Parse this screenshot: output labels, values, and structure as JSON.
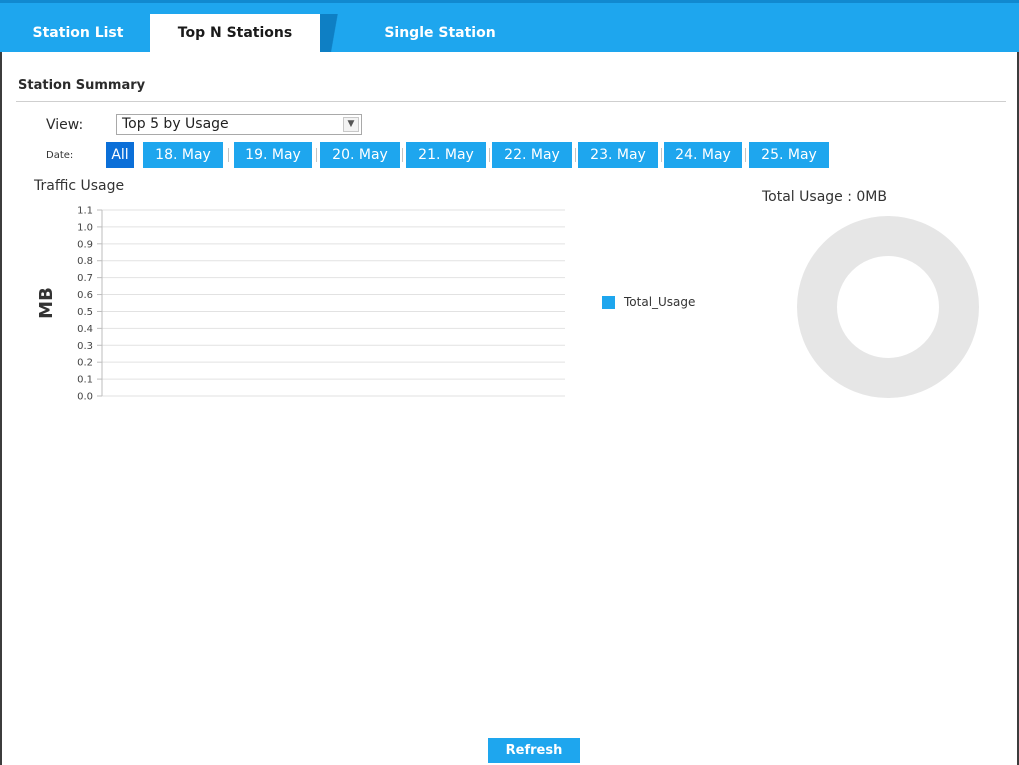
{
  "tabs": [
    {
      "label": "Station List",
      "active": false
    },
    {
      "label": "Top N Stations",
      "active": true
    },
    {
      "label": "Single Station",
      "active": false
    }
  ],
  "summary": {
    "title": "Station Summary",
    "view_label": "View:",
    "view_value": "Top 5 by Usage",
    "date_label": "Date:",
    "dates": [
      "All",
      "18. May",
      "19. May",
      "20. May",
      "21. May",
      "22. May",
      "23. May",
      "24. May",
      "25. May"
    ],
    "active_date": "All"
  },
  "chart_data": {
    "type": "bar",
    "title": "Traffic Usage",
    "ylabel": "MB",
    "ylim": [
      0,
      1.1
    ],
    "y_ticks": [
      "1.1",
      "1.0",
      "0.9",
      "0.8",
      "0.7",
      "0.6",
      "0.5",
      "0.4",
      "0.3",
      "0.2",
      "0.1",
      "0.0"
    ],
    "series": [
      {
        "name": "Total_Usage",
        "values": []
      }
    ],
    "legend": "right",
    "grid": true
  },
  "donut": {
    "total_label": "Total Usage : 0MB",
    "value": 0
  },
  "refresh_label": "Refresh",
  "colors": {
    "accent": "#1ea6ee",
    "active_date": "#0b6fd8",
    "donut_ring": "#e6e6e6"
  }
}
